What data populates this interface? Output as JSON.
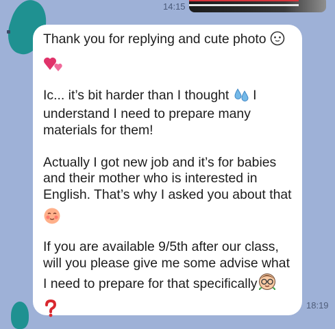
{
  "status_time": "14:15",
  "message": {
    "line1": "Thank you for replying and cute photo",
    "para2_line1": "Ic... it’s bit harder than I thought",
    "para2_line1_end": " I",
    "para2_line2": "understand I need to prepare many",
    "para2_line3": "materials for them!",
    "para3_line1": "Actually I got new job and it’s for babies",
    "para3_line2": "and their mother who is interested in",
    "para3_line3": "English. That’s why I asked you about that",
    "para4_line1": "If you are available 9/5th after our class,",
    "para4_line2": "will you please give me some advise what",
    "para4_line3": "I need to prepare for that specifically",
    "sent_time": "18:19"
  },
  "icons": {
    "face_icon": "face-without-mouth-icon",
    "hearts_icon": "two-hearts-icon",
    "droplets_icon": "sweat-droplets-icon",
    "blush_icon": "smiling-blush-face-icon",
    "nerd_icon": "face-with-glasses-icon",
    "question_icon": "red-question-mark-icon"
  },
  "colors": {
    "background": "#9eb1d7",
    "bubble": "#ffffff",
    "text": "#1d1d1d",
    "accent_teal": "#1f9191"
  }
}
